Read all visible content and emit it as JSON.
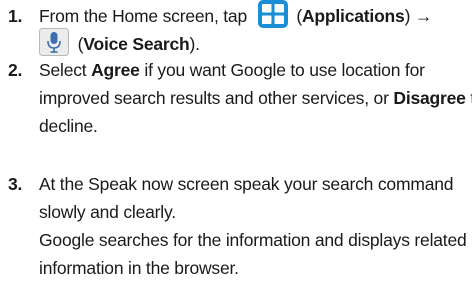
{
  "steps": [
    {
      "number": "1.",
      "text_a": "From the Home screen, tap",
      "text_b": " (",
      "apps_label": "Applications",
      "text_c": ") →",
      "text_d": " (",
      "voice_label": "Voice Search",
      "text_e": ").",
      "icons": [
        "applications-icon",
        "voice-search-icon"
      ]
    },
    {
      "number": "2.",
      "line1_a": "Select ",
      "agree": "Agree",
      "line1_b": " if you want Google to use location for",
      "line2_a": "improved search results and other services, or ",
      "disagree": "Disagree",
      "line2_b": " to",
      "line3": "decline."
    },
    {
      "number": "3.",
      "line1": "At the Speak now screen speak your search command",
      "line2": "slowly and clearly.",
      "line3": "Google searches for the information and displays related",
      "line4": "information in the browser."
    }
  ],
  "colors": {
    "apps_icon_blue": "#1a8fd6",
    "voice_icon_bg": "#ececec",
    "mic_blue": "#3b6fb0",
    "text": "#1a1a1a"
  }
}
